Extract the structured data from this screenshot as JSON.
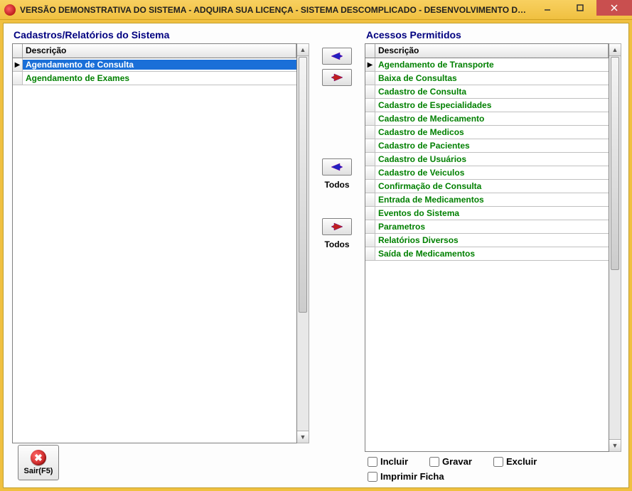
{
  "window": {
    "title": "VERSÃO DEMONSTRATIVA DO SISTEMA - ADQUIRA SUA LICENÇA - SISTEMA DESCOMPLICADO - DESENVOLVIMENTO DE SISTE..."
  },
  "left_panel": {
    "title": "Cadastros/Relatórios do Sistema",
    "header": "Descrição",
    "rows": [
      {
        "label": "Agendamento de Consulta",
        "selected": true,
        "current": true
      },
      {
        "label": "Agendamento de Exames",
        "selected": false,
        "current": false
      }
    ]
  },
  "right_panel": {
    "title": "Acessos Permitidos",
    "header": "Descrição",
    "rows": [
      {
        "label": "Agendamento de Transporte",
        "current": true
      },
      {
        "label": "Baixa de Consultas"
      },
      {
        "label": "Cadastro de Consulta"
      },
      {
        "label": "Cadastro de Especialidades"
      },
      {
        "label": "Cadastro de Medicamento"
      },
      {
        "label": "Cadastro de Medicos"
      },
      {
        "label": "Cadastro de Pacientes"
      },
      {
        "label": "Cadastro de Usuários"
      },
      {
        "label": "Cadastro de Veiculos"
      },
      {
        "label": "Confirmação de Consulta"
      },
      {
        "label": "Entrada de  Medicamentos"
      },
      {
        "label": "Eventos do Sistema"
      },
      {
        "label": "Parametros"
      },
      {
        "label": "Relatórios Diversos"
      },
      {
        "label": "Saída de Medicamentos"
      }
    ]
  },
  "mid": {
    "todos_label": "Todos"
  },
  "checks": {
    "incluir": "Incluir",
    "gravar": "Gravar",
    "excluir": "Excluir",
    "imprimir": "Imprimir Ficha"
  },
  "exit": {
    "label": "Sair(F5)"
  }
}
